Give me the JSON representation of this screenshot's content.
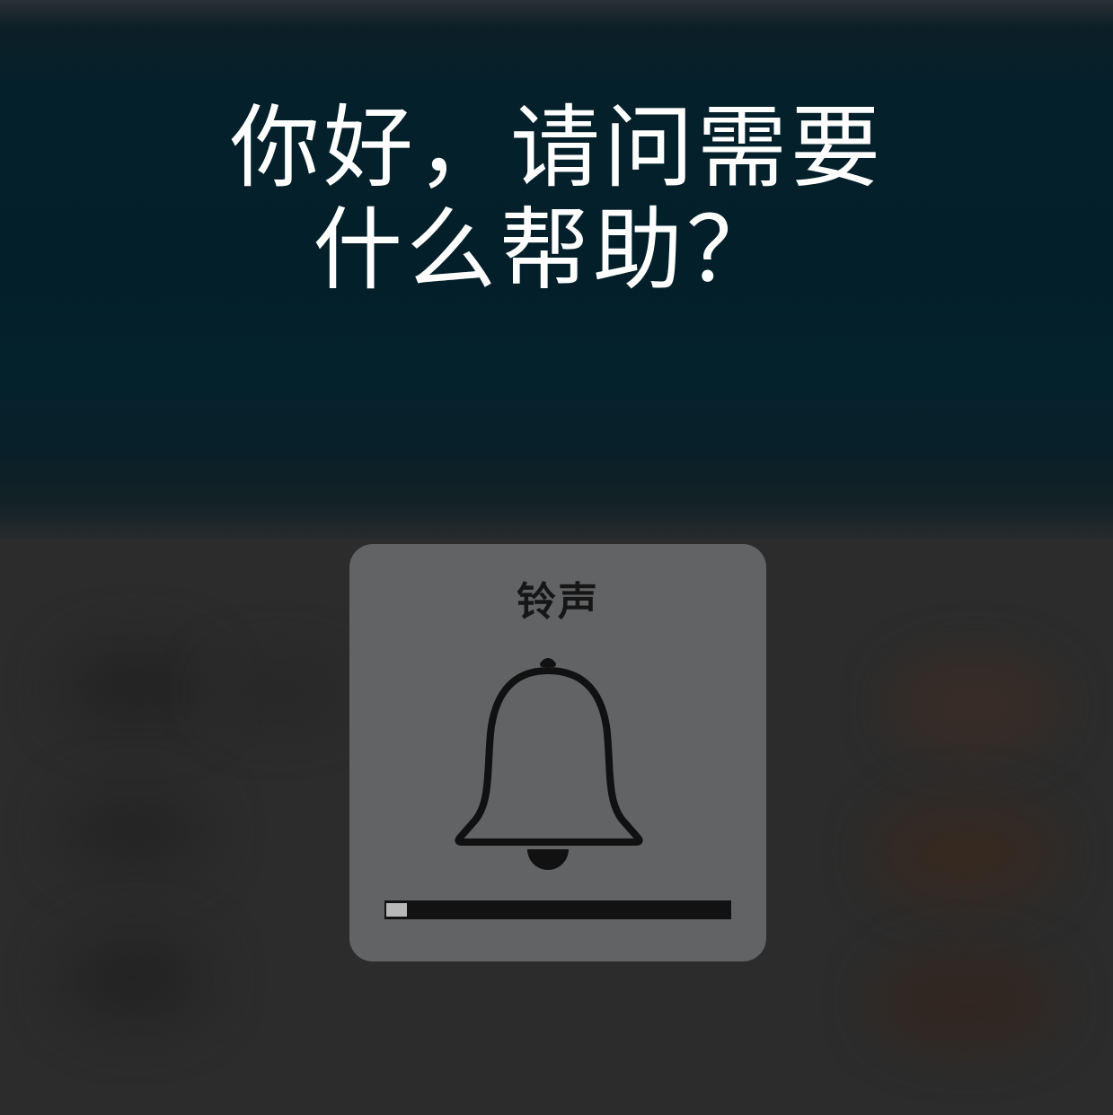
{
  "prompt": {
    "line1": "你好，请问需要",
    "line2": "什么帮助？"
  },
  "hud": {
    "title": "铃声",
    "icon": "bell-icon",
    "volume_level": 0.06
  },
  "colors": {
    "top_background": "#03202a",
    "bottom_background": "#2c2c2c",
    "hud_background": "#626365",
    "bar_track": "#121212",
    "bar_fill": "#b8b8b8",
    "text": "#ffffff"
  }
}
